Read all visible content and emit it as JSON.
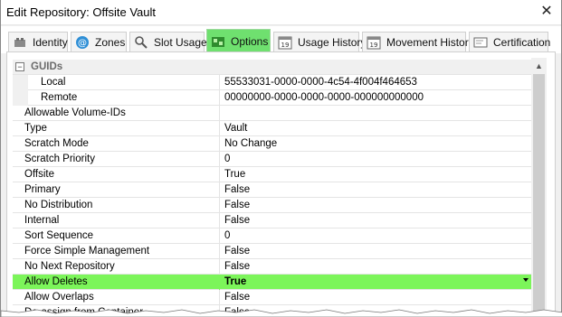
{
  "window": {
    "title": "Edit Repository: Offsite Vault"
  },
  "tabs": [
    {
      "label": "Identity",
      "icon": "gear-icon"
    },
    {
      "label": "Zones",
      "icon": "at-icon"
    },
    {
      "label": "Slot Usage",
      "icon": "magnifier-icon"
    },
    {
      "label": "Options",
      "icon": "options-icon"
    },
    {
      "label": "Usage History",
      "icon": "calendar-icon"
    },
    {
      "label": "Movement History",
      "icon": "calendar-icon"
    },
    {
      "label": "Certification",
      "icon": "certificate-icon"
    }
  ],
  "active_tab": "Options",
  "grid": {
    "category": "GUIDs",
    "collapse_symbol": "⊟",
    "rows": [
      {
        "name": "Local",
        "value": "55533031-0000-0000-4c54-4f004f464653",
        "sub": true
      },
      {
        "name": "Remote",
        "value": "00000000-0000-0000-0000-000000000000",
        "sub": true
      },
      {
        "name": "Allowable Volume-IDs",
        "value": ""
      },
      {
        "name": "Type",
        "value": "Vault"
      },
      {
        "name": "Scratch Mode",
        "value": "No Change"
      },
      {
        "name": "Scratch Priority",
        "value": "0"
      },
      {
        "name": "Offsite",
        "value": "True"
      },
      {
        "name": "Primary",
        "value": "False"
      },
      {
        "name": "No Distribution",
        "value": "False"
      },
      {
        "name": "Internal",
        "value": "False"
      },
      {
        "name": "Sort Sequence",
        "value": "0"
      },
      {
        "name": "Force Simple Management",
        "value": "False"
      },
      {
        "name": "No Next Repository",
        "value": "False"
      },
      {
        "name": "Allow Deletes",
        "value": "True",
        "selected": true
      },
      {
        "name": "Allow Overlaps",
        "value": "False"
      },
      {
        "name": "De-assign from Container",
        "value": "False"
      }
    ]
  },
  "colors": {
    "active_tab": "#6fe06f",
    "selected_row": "#7cf55a"
  }
}
